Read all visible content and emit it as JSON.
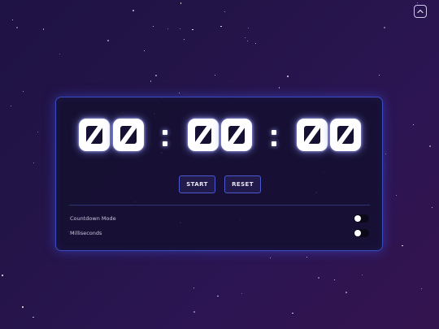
{
  "timer": {
    "hours": "00",
    "minutes": "00",
    "seconds": "00",
    "separator": ":"
  },
  "controls": {
    "start_label": "START",
    "reset_label": "RESET"
  },
  "settings": [
    {
      "label": "Countdown Mode",
      "enabled": false
    },
    {
      "label": "Milliseconds",
      "enabled": false
    }
  ],
  "icons": {
    "corner_button": "chevron-up-icon"
  },
  "colors": {
    "background": "#231447",
    "panel_border": "#3a4cc0",
    "digit": "#ffffff",
    "button_border": "#4b5ad0"
  }
}
